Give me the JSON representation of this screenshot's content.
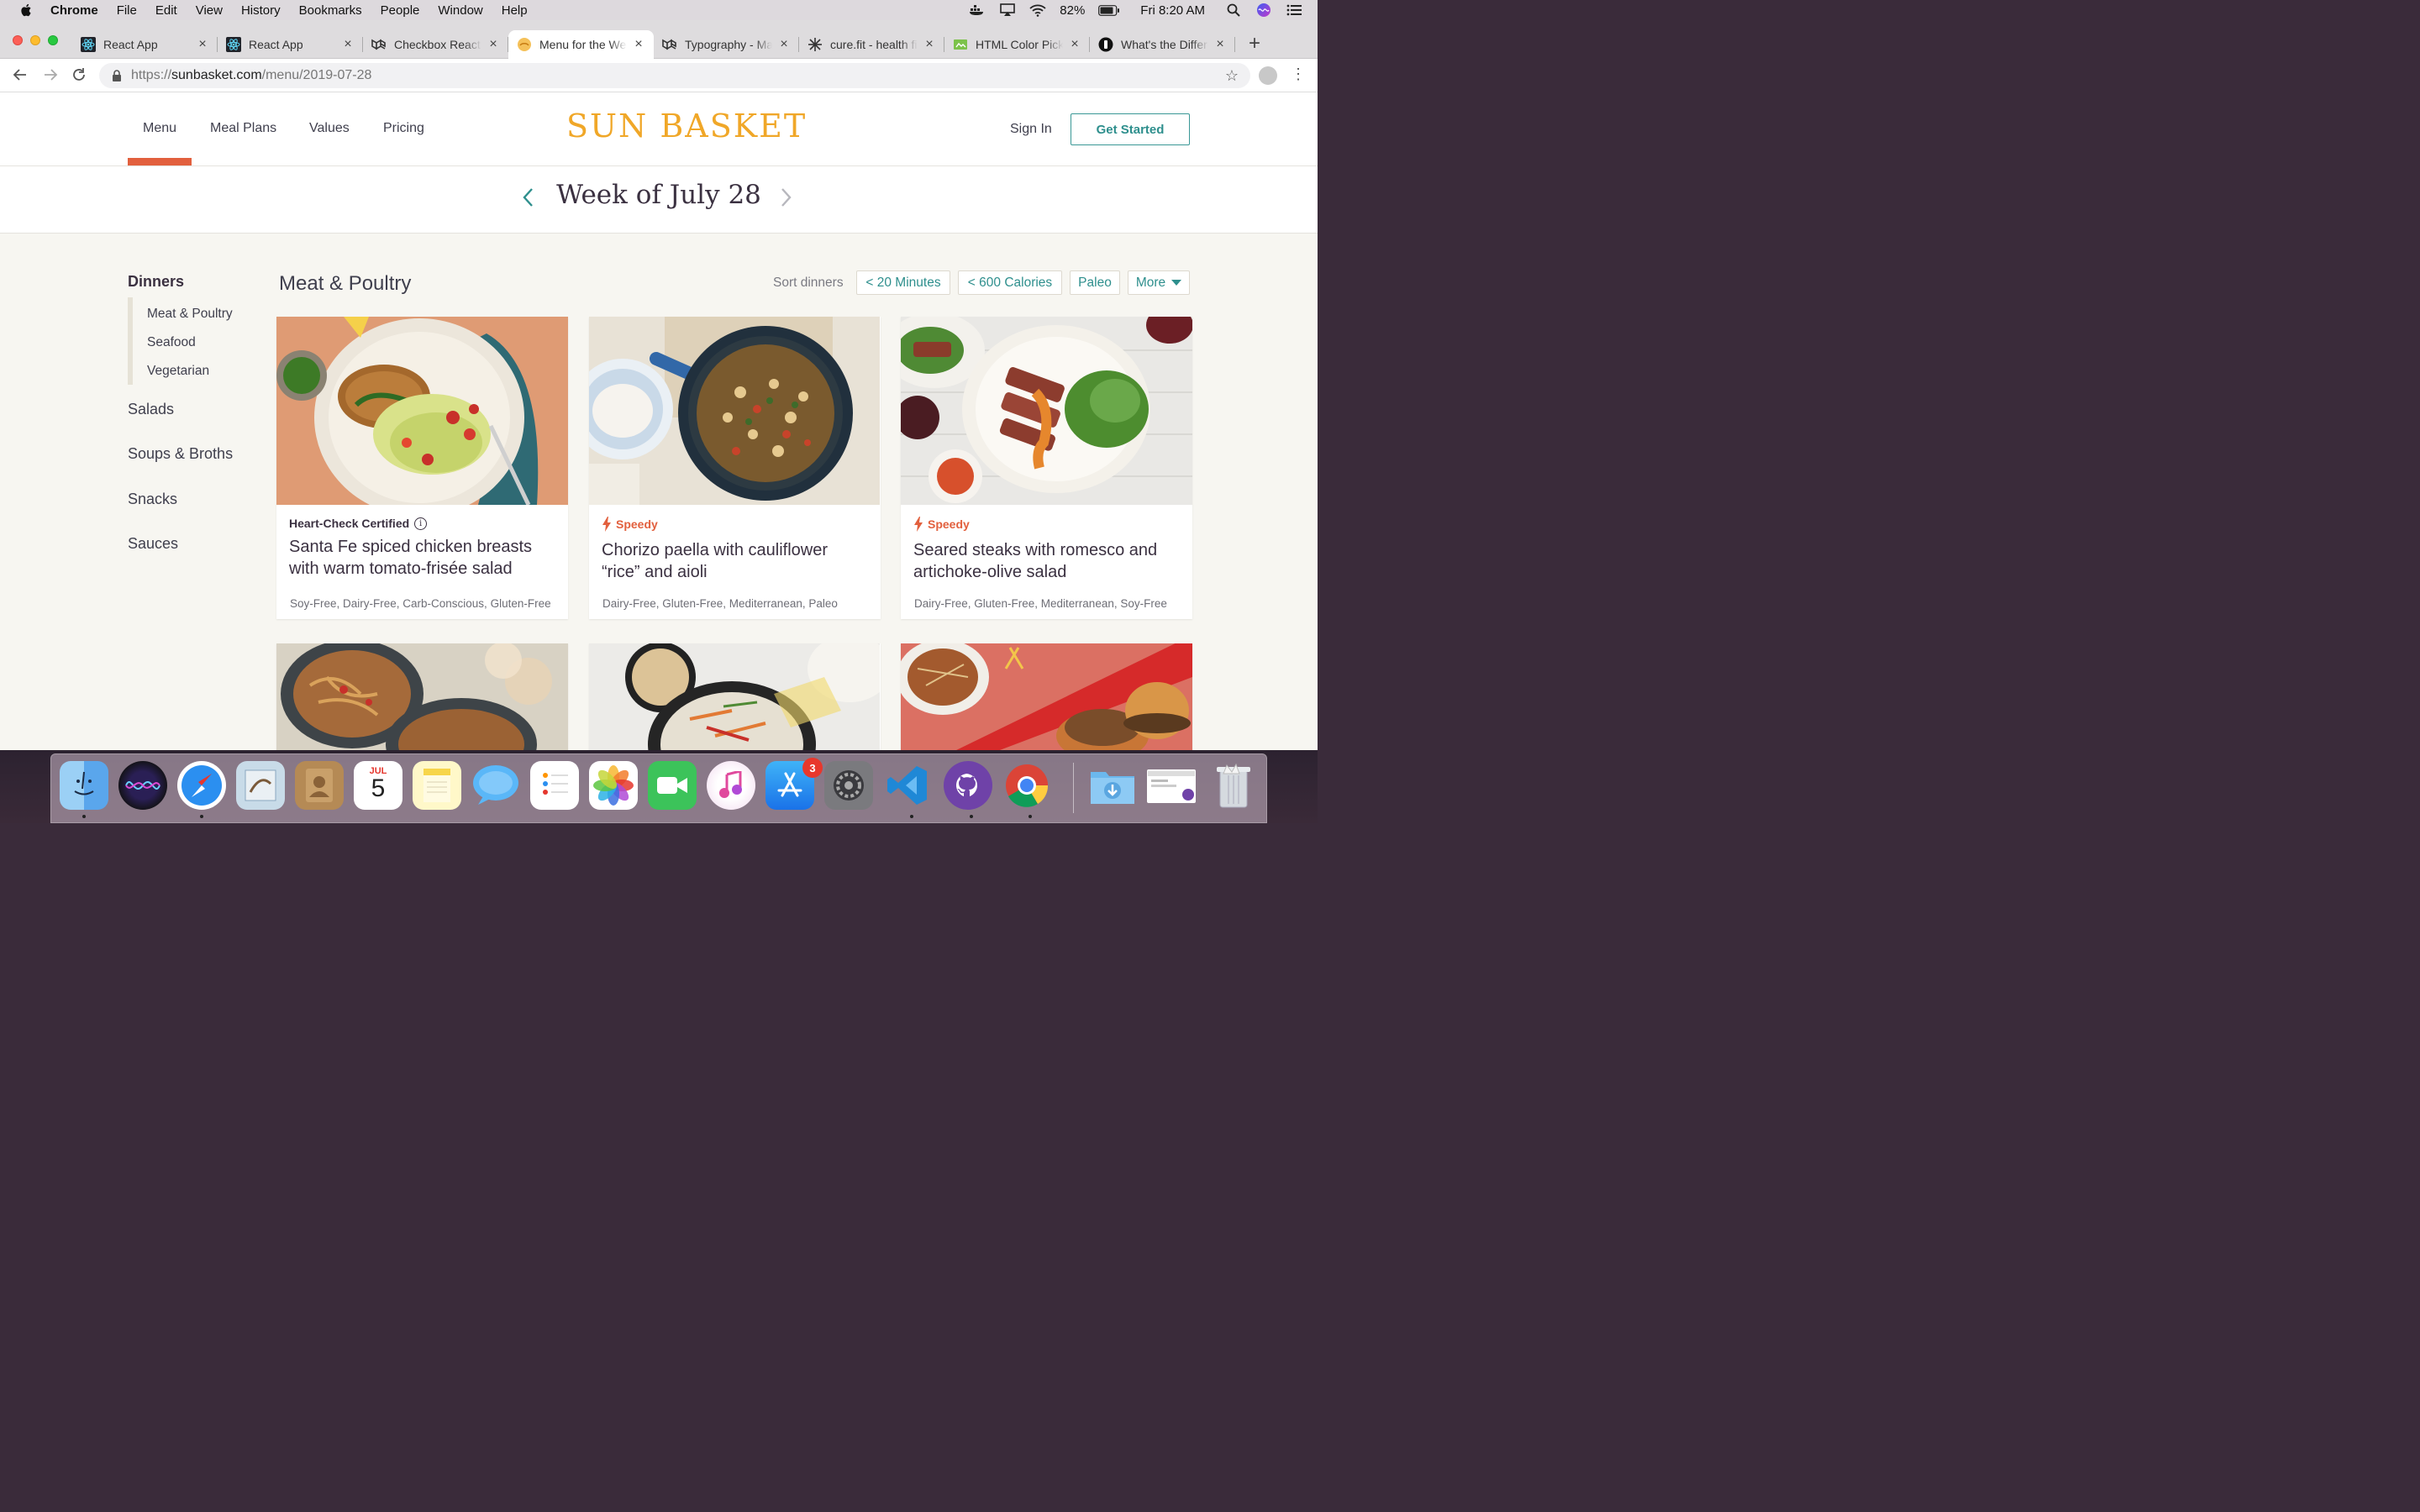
{
  "menubar": {
    "app": "Chrome",
    "items": [
      "File",
      "Edit",
      "View",
      "History",
      "Bookmarks",
      "People",
      "Window",
      "Help"
    ],
    "battery": "82%",
    "clock": "Fri 8:20 AM"
  },
  "tabs": [
    {
      "title": "React App",
      "icon": "react-icon"
    },
    {
      "title": "React App",
      "icon": "react-icon"
    },
    {
      "title": "Checkbox React",
      "icon": "material-ui-icon"
    },
    {
      "title": "Menu for the Week",
      "icon": "sunbasket-icon",
      "active": true
    },
    {
      "title": "Typography - Material",
      "icon": "material-ui-icon"
    },
    {
      "title": "cure.fit - health fitness",
      "icon": "curefit-icon"
    },
    {
      "title": "HTML Color Picker",
      "icon": "colorpicker-icon"
    },
    {
      "title": "What's the Difference",
      "icon": "medium-icon"
    }
  ],
  "address": {
    "protocol": "https://",
    "host": "sunbasket.com",
    "path": "/menu/2019-07-28"
  },
  "site": {
    "nav": [
      "Menu",
      "Meal Plans",
      "Values",
      "Pricing"
    ],
    "logo": "SUN BASKET",
    "sign_in": "Sign In",
    "get_started": "Get Started"
  },
  "week": {
    "title": "Week of July 28"
  },
  "sidebar": {
    "dinners": "Dinners",
    "dinner_subs": [
      "Meat & Poultry",
      "Seafood",
      "Vegetarian"
    ],
    "categories": [
      "Salads",
      "Soups & Broths",
      "Snacks",
      "Sauces"
    ]
  },
  "content": {
    "section_title": "Meat & Poultry",
    "sort_label": "Sort dinners",
    "filters": [
      "< 20 Minutes",
      "< 600 Calories",
      "Paleo",
      "More"
    ]
  },
  "cards": [
    {
      "badge": "Heart-Check Certified",
      "badge_type": "heart-check",
      "title_line1": "Santa Fe spiced chicken breasts",
      "title_line2": "with warm tomato-frisée salad",
      "tags": "Soy-Free, Dairy-Free, Carb-Conscious, Gluten-Free"
    },
    {
      "badge": "Speedy",
      "badge_type": "speedy",
      "title_line1": "Chorizo paella with cauliflower",
      "title_line2": "“rice” and aioli",
      "tags": "Dairy-Free, Gluten-Free, Mediterranean, Paleo"
    },
    {
      "badge": "Speedy",
      "badge_type": "speedy",
      "title_line1": "Seared steaks with romesco and",
      "title_line2": "artichoke-olive salad",
      "tags": "Dairy-Free, Gluten-Free, Mediterranean, Soy-Free"
    }
  ],
  "dock": {
    "calendar_month": "JUL",
    "calendar_day": "5",
    "appstore_badge": "3"
  },
  "colors": {
    "accent_teal": "#2e8f8d",
    "accent_orange": "#e2603e",
    "logo_gold": "#f0a728",
    "text_dark": "#3b3141",
    "page_bg": "#f7f6f1"
  }
}
